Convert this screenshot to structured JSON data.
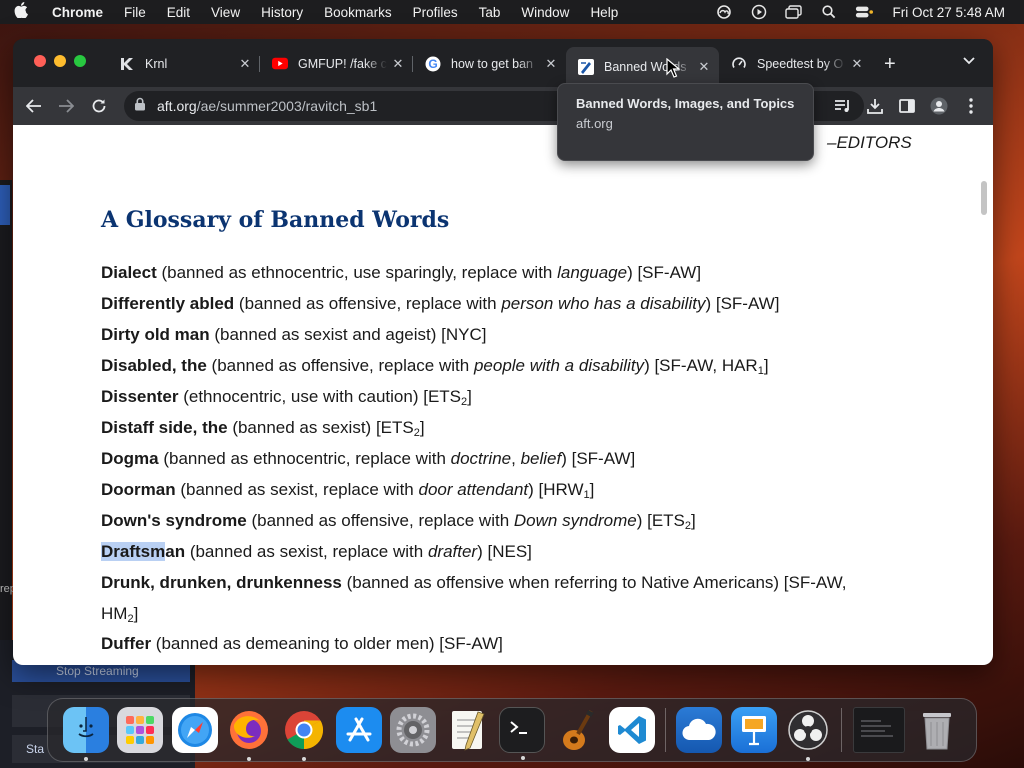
{
  "menubar": {
    "app_name": "Chrome",
    "items": [
      "File",
      "Edit",
      "View",
      "History",
      "Bookmarks",
      "Profiles",
      "Tab",
      "Window",
      "Help"
    ],
    "clock": "Fri Oct 27  5:48 AM",
    "status_icons": [
      "creative-cloud-icon",
      "play-icon",
      "screen-mirror-icon",
      "spotlight-search-icon",
      "control-center-icon"
    ]
  },
  "background": {
    "obs_stop_label": "Stop Streaming",
    "obs_start_label": "Sta",
    "obs_side_text": "rep"
  },
  "tabs": [
    {
      "title": "Krnl",
      "icon": "krnl-icon",
      "active": false
    },
    {
      "title": "GMFUP! /fake c",
      "icon": "youtube-icon",
      "active": false
    },
    {
      "title": "how to get ban",
      "icon": "google-icon",
      "active": false
    },
    {
      "title": "Banned Words",
      "icon": "aft-icon",
      "active": true
    },
    {
      "title": "Speedtest by O",
      "icon": "speedtest-icon",
      "active": false
    }
  ],
  "omnibox": {
    "host": "aft.org",
    "path": "/ae/summer2003/ravitch_sb1"
  },
  "tooltip": {
    "title": "Banned Words, Images, and Topics",
    "host": "aft.org"
  },
  "page": {
    "editors": "–EDITORS",
    "heading": "A Glossary of Banned Words",
    "entries": {
      "e1": {
        "term": "Dialect",
        "pre": " (banned as ethnocentric, use sparingly, replace with ",
        "repl": "language",
        "post": ") [SF-AW]"
      },
      "e2": {
        "term": "Differently abled",
        "pre": " (banned as offensive, replace with ",
        "repl": "person who has a disability",
        "post": ") [SF-AW]"
      },
      "e3": {
        "term": "Dirty old man",
        "pre": " (banned as sexist and ageist) [NYC]"
      },
      "e4": {
        "term": "Disabled, the",
        "pre": " (banned as offensive, replace with ",
        "repl": "people with a disability",
        "post": ") [SF-AW, HAR",
        "sub": "1",
        "tail": "]"
      },
      "e5": {
        "term": "Dissenter",
        "pre": " (ethnocentric, use with caution) [ETS",
        "sub": "2",
        "tail": "]"
      },
      "e6": {
        "term": "Distaff side, the",
        "pre": " (banned as sexist) [ETS",
        "sub": "2",
        "tail": "]"
      },
      "e7": {
        "term": "Dogma",
        "pre": " (banned as ethnocentric, replace with ",
        "repl": "doctrine",
        "mid": ", ",
        "repl2": "belief",
        "post": ") [SF-AW]"
      },
      "e8": {
        "term": "Doorman",
        "pre": " (banned as sexist, replace with ",
        "repl": "door attendant",
        "post": ") [HRW",
        "sub": "1",
        "tail": "]"
      },
      "e9": {
        "term": "Down's syndrome",
        "pre": " (banned as offensive, replace with ",
        "repl": "Down syndrome",
        "post": ") [ETS",
        "sub": "2",
        "tail": "]"
      },
      "e10": {
        "term_hl": "Draftsm",
        "term_rest": "an",
        "pre": " (banned as sexist, replace with ",
        "repl": "drafter",
        "post": ") [NES]"
      },
      "e11": {
        "term": "Drunk, drunken, drunkenness",
        "pre": " (banned as offensive when referring to Native Americans) [SF-AW,",
        "line2": "HM",
        "sub": "2",
        "tail": "]"
      },
      "e12": {
        "term": "Duffer",
        "pre": " (banned as demeaning to older men) [SF-AW]"
      }
    }
  },
  "dock": {
    "apps": [
      "finder-icon",
      "launchpad-icon",
      "safari-icon",
      "firefox-icon",
      "chrome-icon",
      "app-store-icon",
      "system-settings-icon",
      "textedit-icon",
      "terminal-icon",
      "garageband-icon",
      "vscode-icon",
      "icloud-drive-icon",
      "keynote-icon",
      "obs-icon",
      "minimized-window-icon",
      "trash-icon"
    ]
  }
}
